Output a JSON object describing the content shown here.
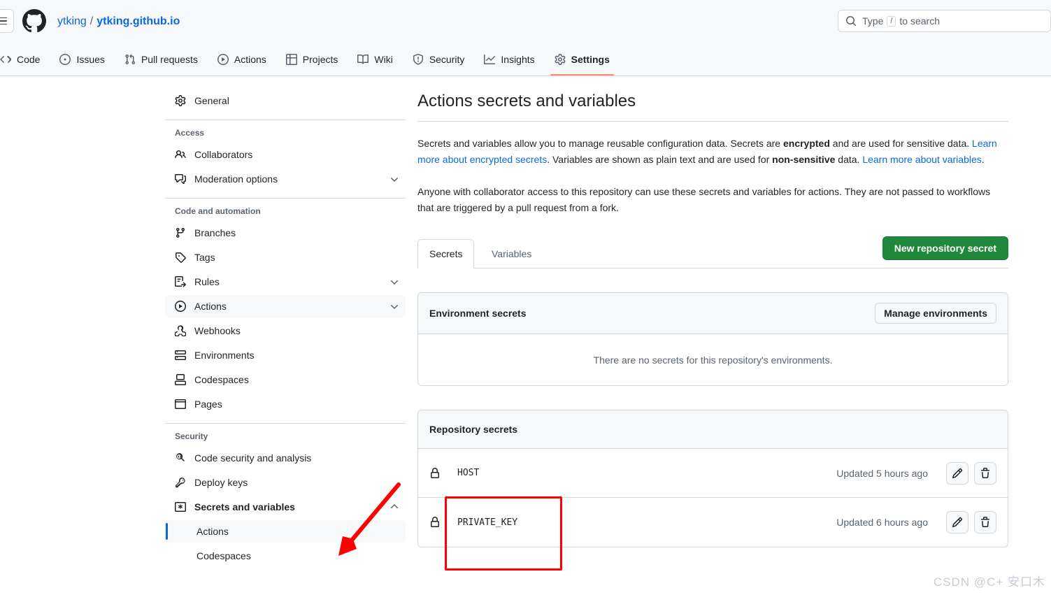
{
  "header": {
    "menu_icon": "hamburger-icon",
    "logo_icon": "github-logo-icon",
    "repo_owner": "ytking",
    "repo_separator": "/",
    "repo_name": "ytking.github.io",
    "search": {
      "icon": "search-icon",
      "placeholder_prefix": "Type",
      "slash_key": "/",
      "placeholder_suffix": "to search"
    }
  },
  "repo_nav": {
    "items": [
      {
        "label": "Code",
        "icon": "code-icon",
        "active": false
      },
      {
        "label": "Issues",
        "icon": "issue-opened-icon",
        "active": false
      },
      {
        "label": "Pull requests",
        "icon": "git-pull-request-icon",
        "active": false
      },
      {
        "label": "Actions",
        "icon": "play-icon",
        "active": false
      },
      {
        "label": "Projects",
        "icon": "table-icon",
        "active": false
      },
      {
        "label": "Wiki",
        "icon": "book-icon",
        "active": false
      },
      {
        "label": "Security",
        "icon": "shield-icon",
        "active": false
      },
      {
        "label": "Insights",
        "icon": "graph-icon",
        "active": false
      },
      {
        "label": "Settings",
        "icon": "gear-icon",
        "active": true
      }
    ],
    "active_underline_color": "#fd8c73"
  },
  "sidebar": {
    "general": {
      "label": "General",
      "icon": "gear-icon"
    },
    "groups": [
      {
        "title": "Access",
        "items": [
          {
            "label": "Collaborators",
            "icon": "people-icon",
            "chevron": ""
          },
          {
            "label": "Moderation options",
            "icon": "comment-discussion-icon",
            "chevron": "chevron-down-icon"
          }
        ]
      },
      {
        "title": "Code and automation",
        "items": [
          {
            "label": "Branches",
            "icon": "git-branch-icon",
            "chevron": ""
          },
          {
            "label": "Tags",
            "icon": "tag-icon",
            "chevron": ""
          },
          {
            "label": "Rules",
            "icon": "rules-icon",
            "chevron": "chevron-down-icon"
          },
          {
            "label": "Actions",
            "icon": "play-icon",
            "chevron": "chevron-down-icon",
            "selected": true
          },
          {
            "label": "Webhooks",
            "icon": "webhook-icon",
            "chevron": ""
          },
          {
            "label": "Environments",
            "icon": "server-icon",
            "chevron": ""
          },
          {
            "label": "Codespaces",
            "icon": "codespaces-icon",
            "chevron": ""
          },
          {
            "label": "Pages",
            "icon": "browser-icon",
            "chevron": ""
          }
        ]
      },
      {
        "title": "Security",
        "items": [
          {
            "label": "Code security and analysis",
            "icon": "codescan-icon",
            "chevron": ""
          },
          {
            "label": "Deploy keys",
            "icon": "key-icon",
            "chevron": ""
          },
          {
            "label": "Secrets and variables",
            "icon": "asterisk-box-icon",
            "chevron": "chevron-up-icon",
            "bold": true
          }
        ],
        "sub_items": [
          {
            "label": "Actions",
            "selected": true
          },
          {
            "label": "Codespaces",
            "selected": false
          }
        ]
      }
    ],
    "selected_indicator_color": "#0969da"
  },
  "main": {
    "title": "Actions secrets and variables",
    "paragraph1": {
      "t1": "Secrets and variables allow you to manage reusable configuration data. Secrets are ",
      "b1": "encrypted",
      "t2": " and are used for sensitive data. ",
      "link1": "Learn more about encrypted secrets",
      "t3": ". Variables are shown as plain text and are used for ",
      "b2": "non-sensitive",
      "t4": " data. ",
      "link2": "Learn more about variables",
      "t5": "."
    },
    "paragraph2": "Anyone with collaborator access to this repository can use these secrets and variables for actions. They are not passed to workflows that are triggered by a pull request from a fork.",
    "tabs": [
      {
        "label": "Secrets",
        "active": true
      },
      {
        "label": "Variables",
        "active": false
      }
    ],
    "new_secret_button": "New repository secret",
    "environment_panel": {
      "title": "Environment secrets",
      "manage_button": "Manage environments",
      "empty_message": "There are no secrets for this repository's environments."
    },
    "repository_panel": {
      "title": "Repository secrets",
      "rows": [
        {
          "lock_icon": "lock-icon",
          "name": "HOST",
          "updated": "Updated 5 hours ago",
          "edit_icon": "pencil-icon",
          "delete_icon": "trash-icon"
        },
        {
          "lock_icon": "lock-icon",
          "name": "PRIVATE_KEY",
          "updated": "Updated 6 hours ago",
          "edit_icon": "pencil-icon",
          "delete_icon": "trash-icon"
        }
      ]
    }
  },
  "annotations": {
    "highlight_box_color": "#ff0000",
    "arrow_color": "#ff0000"
  },
  "watermark": "CSDN @C+  安口木",
  "colors": {
    "green_button": "#1f883d",
    "link": "#0969da",
    "active_tab_underline": "#fd8c73",
    "panel_header_bg": "#f6f8fa",
    "border": "#d1d9e0"
  }
}
